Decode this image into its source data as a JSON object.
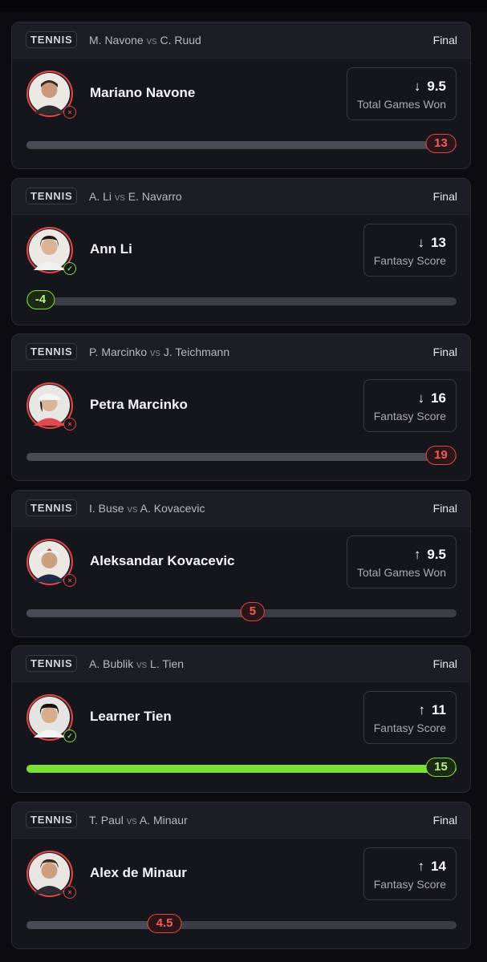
{
  "cards": [
    {
      "sport": "TENNIS",
      "player_a": "M. Navone",
      "vs": "vs",
      "player_b": "C. Ruud",
      "status": "Final",
      "player": "Mariano Navone",
      "result": "lost",
      "direction": "down",
      "direction_symbol": "↓",
      "line": "9.5",
      "stat": "Total Games Won",
      "actual": "13",
      "progress": 1.0
    },
    {
      "sport": "TENNIS",
      "player_a": "A. Li",
      "vs": "vs",
      "player_b": "E. Navarro",
      "status": "Final",
      "player": "Ann Li",
      "result": "won",
      "direction": "down",
      "direction_symbol": "↓",
      "line": "13",
      "stat": "Fantasy Score",
      "actual": "-4",
      "progress": 0.0
    },
    {
      "sport": "TENNIS",
      "player_a": "P. Marcinko",
      "vs": "vs",
      "player_b": "J. Teichmann",
      "status": "Final",
      "player": "Petra Marcinko",
      "result": "lost",
      "direction": "down",
      "direction_symbol": "↓",
      "line": "16",
      "stat": "Fantasy Score",
      "actual": "19",
      "progress": 1.0
    },
    {
      "sport": "TENNIS",
      "player_a": "I. Buse",
      "vs": "vs",
      "player_b": "A. Kovacevic",
      "status": "Final",
      "player": "Aleksandar Kovacevic",
      "result": "lost",
      "direction": "up",
      "direction_symbol": "↑",
      "line": "9.5",
      "stat": "Total Games Won",
      "actual": "5",
      "progress": 0.526
    },
    {
      "sport": "TENNIS",
      "player_a": "A. Bublik",
      "vs": "vs",
      "player_b": "L. Tien",
      "status": "Final",
      "player": "Learner Tien",
      "result": "won",
      "direction": "up",
      "direction_symbol": "↑",
      "line": "11",
      "stat": "Fantasy Score",
      "actual": "15",
      "progress": 1.0
    },
    {
      "sport": "TENNIS",
      "player_a": "T. Paul",
      "vs": "vs",
      "player_b": "A. Minaur",
      "status": "Final",
      "player": "Alex de Minaur",
      "result": "lost",
      "direction": "up",
      "direction_symbol": "↑",
      "line": "14",
      "stat": "Fantasy Score",
      "actual": "4.5",
      "progress": 0.321
    }
  ],
  "badges": {
    "won": "✓",
    "lost": "×"
  },
  "colors": {
    "won": "#7de03a",
    "lost": "#e34545",
    "card_bg": "#15151c",
    "page_bg": "#0b0b10"
  }
}
